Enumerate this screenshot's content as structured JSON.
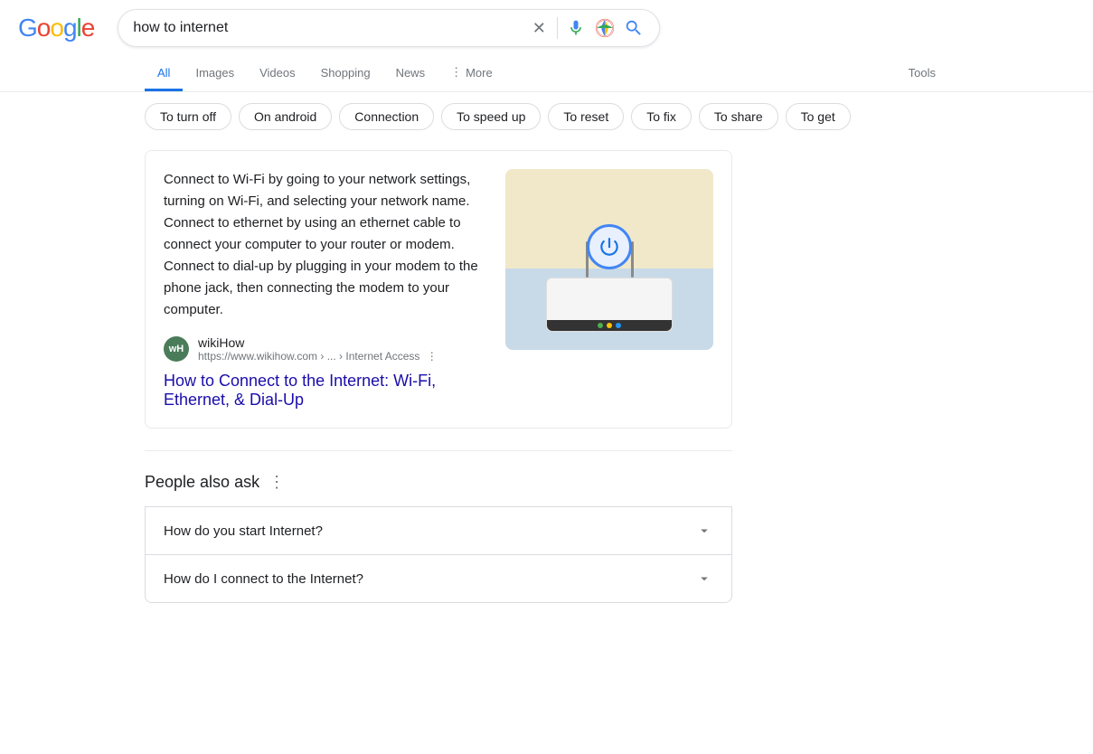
{
  "logo": {
    "letters": [
      "G",
      "o",
      "o",
      "g",
      "l",
      "e"
    ]
  },
  "searchBar": {
    "query": "how to internet",
    "placeholder": "Search",
    "clearLabel": "×"
  },
  "navTabs": {
    "tabs": [
      {
        "label": "All",
        "active": true
      },
      {
        "label": "Images",
        "active": false
      },
      {
        "label": "Videos",
        "active": false
      },
      {
        "label": "Shopping",
        "active": false
      },
      {
        "label": "News",
        "active": false
      },
      {
        "label": "More",
        "active": false
      }
    ],
    "tools": "Tools"
  },
  "chips": [
    "To turn off",
    "On android",
    "Connection",
    "To speed up",
    "To reset",
    "To fix",
    "To share",
    "To get"
  ],
  "featuredSnippet": {
    "text": "Connect to Wi-Fi by going to your network settings, turning on Wi-Fi, and selecting your network name. Connect to ethernet by using an ethernet cable to connect your computer to your router or modem. Connect to dial-up by plugging in your modem to the phone jack, then connecting the modem to your computer.",
    "source": {
      "name": "wikiHow",
      "favicon": "wH",
      "url": "https://www.wikihow.com › ... › Internet Access",
      "menuDots": "⋮"
    },
    "linkText": "How to Connect to the Internet: Wi-Fi, Ethernet, & Dial-Up"
  },
  "peopleAlsoAsk": {
    "title": "People also ask",
    "menuDots": "⋮",
    "questions": [
      "How do you start Internet?",
      "How do I connect to the Internet?"
    ]
  }
}
